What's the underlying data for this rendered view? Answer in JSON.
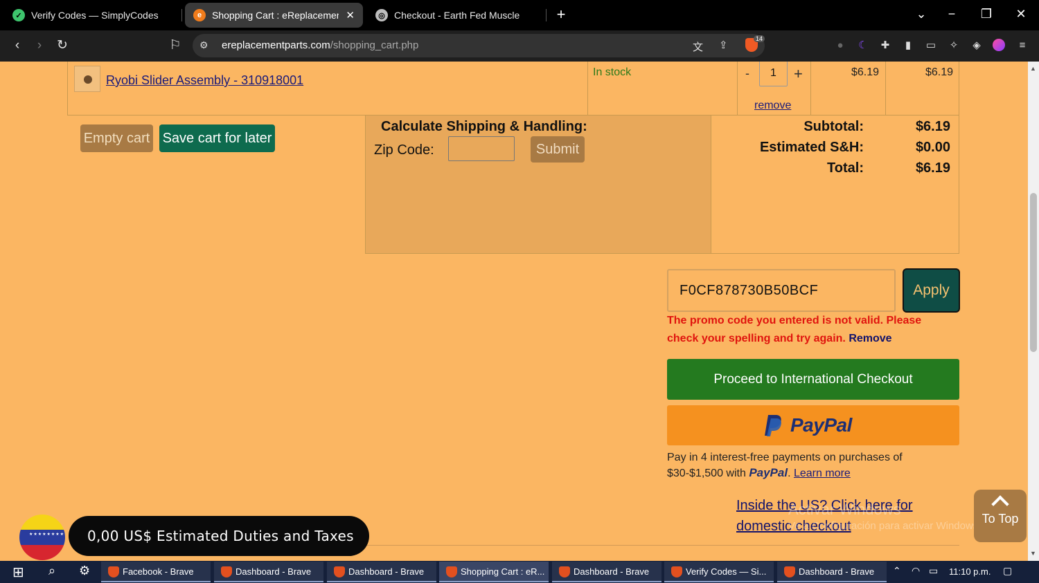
{
  "browser": {
    "tabs": [
      {
        "title": "Verify Codes — SimplyCodes",
        "active": false
      },
      {
        "title": "Shopping Cart : eReplacementP",
        "active": true
      },
      {
        "title": "Checkout - Earth Fed Muscle",
        "active": false
      }
    ],
    "new_tab_icon": "plus-icon",
    "url_domain": "ereplacementparts.com",
    "url_path": "/shopping_cart.php",
    "shield_badge": "14"
  },
  "cart": {
    "item": {
      "name": "Ryobi Slider Assembly - 310918001",
      "stock": "In stock",
      "qty_minus": "-",
      "qty": "1",
      "qty_plus": "+",
      "remove": "remove",
      "unit_price": "$6.19",
      "line_total": "$6.19"
    },
    "buttons": {
      "empty": "Empty cart",
      "save": "Save cart for later"
    }
  },
  "shipping": {
    "title": "Calculate Shipping & Handling:",
    "zip_label": "Zip Code:",
    "zip_value": "",
    "submit": "Submit"
  },
  "totals": {
    "subtotal_label": "Subtotal:",
    "subtotal": "$6.19",
    "sh_label": "Estimated S&H:",
    "sh": "$0.00",
    "total_label": "Total:",
    "total": "$6.19"
  },
  "promo": {
    "code": "F0CF878730B50BCF",
    "apply": "Apply",
    "error": "The promo code you entered is not valid. Please check your spelling and try again.",
    "remove": "Remove"
  },
  "checkout": {
    "international": "Proceed to International Checkout",
    "paypal_logo": "PayPal",
    "paylater_text": "Pay in 4 interest-free payments on purchases of $30-$1,500 with",
    "paylater_brand": "PayPal",
    "learn_more": "Learn more",
    "domestic": "Inside the US? Click here for domestic checkout"
  },
  "overlay": {
    "duties": "0,00 US$ Estimated Duties and Taxes",
    "to_top": "To Top",
    "watermark_title": "Activar Windows",
    "watermark_sub": "Ve a Configuración para activar Windows."
  },
  "taskbar": {
    "items": [
      {
        "label": "Facebook - Brave"
      },
      {
        "label": "Dashboard - Brave"
      },
      {
        "label": "Dashboard - Brave"
      },
      {
        "label": "Shopping Cart : eR..."
      },
      {
        "label": "Dashboard - Brave"
      },
      {
        "label": "Verify Codes — Si..."
      },
      {
        "label": "Dashboard - Brave"
      }
    ],
    "clock": "11:10 p.m."
  },
  "colors": {
    "page_bg": "#FBB662",
    "save_button": "#0E6B4E",
    "apply_button": "#0F4D45",
    "international_checkout": "#247A1F",
    "paypal_button": "#F5911F",
    "error_text": "#e0140e"
  }
}
